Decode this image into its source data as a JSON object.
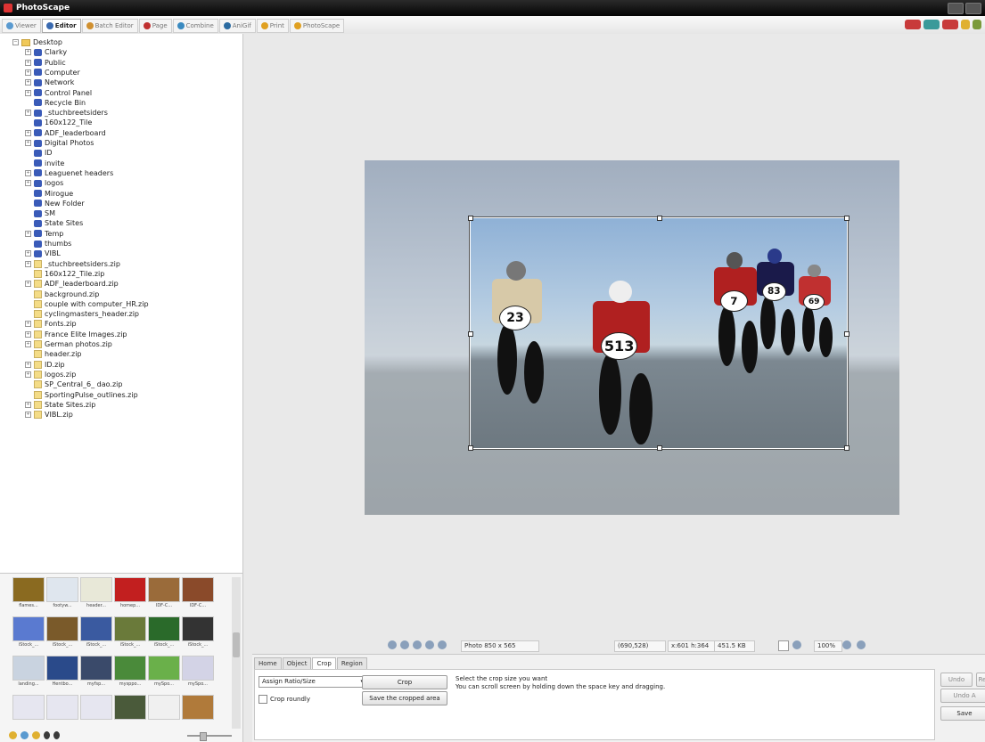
{
  "window": {
    "title": "PhotoScape"
  },
  "menu_tabs": [
    "Viewer",
    "Editor",
    "Batch Editor",
    "Page",
    "Combine",
    "AniGif",
    "Print",
    "PhotoScape"
  ],
  "active_menu_tab": "Editor",
  "folder_tree": [
    {
      "label": "Desktop",
      "level": 0,
      "icon": "folder",
      "expander": "−"
    },
    {
      "label": "Clarky",
      "level": 1,
      "icon": "user",
      "expander": "+"
    },
    {
      "label": "Public",
      "level": 1,
      "icon": "folder-blue",
      "expander": "+"
    },
    {
      "label": "Computer",
      "level": 1,
      "icon": "computer",
      "expander": "+"
    },
    {
      "label": "Network",
      "level": 1,
      "icon": "network",
      "expander": "+"
    },
    {
      "label": "Control Panel",
      "level": 1,
      "icon": "control-panel",
      "expander": "+"
    },
    {
      "label": "Recycle Bin",
      "level": 1,
      "icon": "recycle-bin",
      "expander": ""
    },
    {
      "label": "_stuchbreetsiders",
      "level": 1,
      "icon": "folder-blue",
      "expander": "+"
    },
    {
      "label": "160x122_Tile",
      "level": 1,
      "icon": "folder-blue",
      "expander": ""
    },
    {
      "label": "ADF_leaderboard",
      "level": 1,
      "icon": "folder-blue",
      "expander": "+"
    },
    {
      "label": "Digital Photos",
      "level": 1,
      "icon": "folder-blue",
      "expander": "+"
    },
    {
      "label": "ID",
      "level": 1,
      "icon": "folder-blue",
      "expander": ""
    },
    {
      "label": "invite",
      "level": 1,
      "icon": "folder-blue",
      "expander": ""
    },
    {
      "label": "Leaguenet headers",
      "level": 1,
      "icon": "folder-blue",
      "expander": "+"
    },
    {
      "label": "logos",
      "level": 1,
      "icon": "folder-blue",
      "expander": "+"
    },
    {
      "label": "Mirogue",
      "level": 1,
      "icon": "folder-blue",
      "expander": ""
    },
    {
      "label": "New Folder",
      "level": 1,
      "icon": "folder-blue",
      "expander": ""
    },
    {
      "label": "SM",
      "level": 1,
      "icon": "folder-blue",
      "expander": ""
    },
    {
      "label": "State Sites",
      "level": 1,
      "icon": "folder-blue",
      "expander": ""
    },
    {
      "label": "Temp",
      "level": 1,
      "icon": "folder-blue",
      "expander": "+"
    },
    {
      "label": "thumbs",
      "level": 1,
      "icon": "folder-blue",
      "expander": ""
    },
    {
      "label": "VIBL",
      "level": 1,
      "icon": "folder-blue",
      "expander": "+"
    },
    {
      "label": "_stuchbreetsiders.zip",
      "level": 1,
      "icon": "zip",
      "expander": "+"
    },
    {
      "label": "160x122_Tile.zip",
      "level": 1,
      "icon": "zip",
      "expander": ""
    },
    {
      "label": "ADF_leaderboard.zip",
      "level": 1,
      "icon": "zip",
      "expander": "+"
    },
    {
      "label": "background.zip",
      "level": 1,
      "icon": "zip",
      "expander": ""
    },
    {
      "label": "couple with computer_HR.zip",
      "level": 1,
      "icon": "zip",
      "expander": ""
    },
    {
      "label": "cyclingmasters_header.zip",
      "level": 1,
      "icon": "zip",
      "expander": ""
    },
    {
      "label": "Fonts.zip",
      "level": 1,
      "icon": "zip",
      "expander": "+"
    },
    {
      "label": "France Elite Images.zip",
      "level": 1,
      "icon": "zip",
      "expander": "+"
    },
    {
      "label": "German photos.zip",
      "level": 1,
      "icon": "zip",
      "expander": "+"
    },
    {
      "label": "header.zip",
      "level": 1,
      "icon": "zip",
      "expander": ""
    },
    {
      "label": "ID.zip",
      "level": 1,
      "icon": "zip",
      "expander": "+"
    },
    {
      "label": "logos.zip",
      "level": 1,
      "icon": "zip",
      "expander": "+"
    },
    {
      "label": "SP_Central_6_ dao.zip",
      "level": 1,
      "icon": "zip",
      "expander": ""
    },
    {
      "label": "SportingPulse_outlines.zip",
      "level": 1,
      "icon": "zip",
      "expander": ""
    },
    {
      "label": "State Sites.zip",
      "level": 1,
      "icon": "zip",
      "expander": "+"
    },
    {
      "label": "VIBL.zip",
      "level": 1,
      "icon": "zip",
      "expander": "+"
    }
  ],
  "thumbnails": [
    {
      "label": "flames...",
      "color": "#8a6a20"
    },
    {
      "label": "footyw...",
      "color": "#dfe6ee"
    },
    {
      "label": "header...",
      "color": "#e8e8d8"
    },
    {
      "label": "homep...",
      "color": "#c21f1f"
    },
    {
      "label": "IDF-C...",
      "color": "#9a6b3a"
    },
    {
      "label": "IDF-C...",
      "color": "#8a4a2a"
    },
    {
      "label": "iStock_...",
      "color": "#5a7ad0"
    },
    {
      "label": "iStock_...",
      "color": "#7a5a2a"
    },
    {
      "label": "iStock_...",
      "color": "#3a5aa0"
    },
    {
      "label": "iStock_...",
      "color": "#6a7a3a"
    },
    {
      "label": "iStock_...",
      "color": "#2a6a2a"
    },
    {
      "label": "iStock_...",
      "color": "#333333"
    },
    {
      "label": "landing...",
      "color": "#c9d3e0"
    },
    {
      "label": "Hentbo...",
      "color": "#2a4a8a"
    },
    {
      "label": "myfsp...",
      "color": "#3a4a6a"
    },
    {
      "label": "mysppo...",
      "color": "#4a8a3a"
    },
    {
      "label": "mySpo...",
      "color": "#6ab04a"
    },
    {
      "label": "mySpo...",
      "color": "#d3d3e6"
    },
    {
      "label": "",
      "color": "#e6e6f0"
    },
    {
      "label": "",
      "color": "#e6e6f0"
    },
    {
      "label": "",
      "color": "#e6e6f0"
    },
    {
      "label": "",
      "color": "#4a5a3a"
    },
    {
      "label": "",
      "color": "#f0f0f0"
    },
    {
      "label": "",
      "color": "#b07a3a"
    }
  ],
  "status": {
    "photo_size": "Photo 850 x 565",
    "coords": "(690,528)",
    "selection": "x:601 h:364",
    "file_size": "451.5 KB",
    "zoom": "100%"
  },
  "edit_tabs": [
    "Home",
    "Object",
    "Crop",
    "Region"
  ],
  "active_edit_tab": "Crop",
  "crop": {
    "ratio_select": "Assign Ratio/Size",
    "crop_button": "Crop",
    "save_button": "Save the cropped area",
    "roundly_label": "Crop roundly",
    "hint_line1": "Select the crop size you want",
    "hint_line2": "You can scroll screen by holding down the space key and dragging."
  },
  "side_buttons": {
    "undo": "Undo",
    "redo": "Re",
    "undo_all": "Undo A",
    "save": "Save"
  },
  "photo": {
    "plates": [
      "23",
      "513",
      "7",
      "83",
      "69"
    ]
  }
}
